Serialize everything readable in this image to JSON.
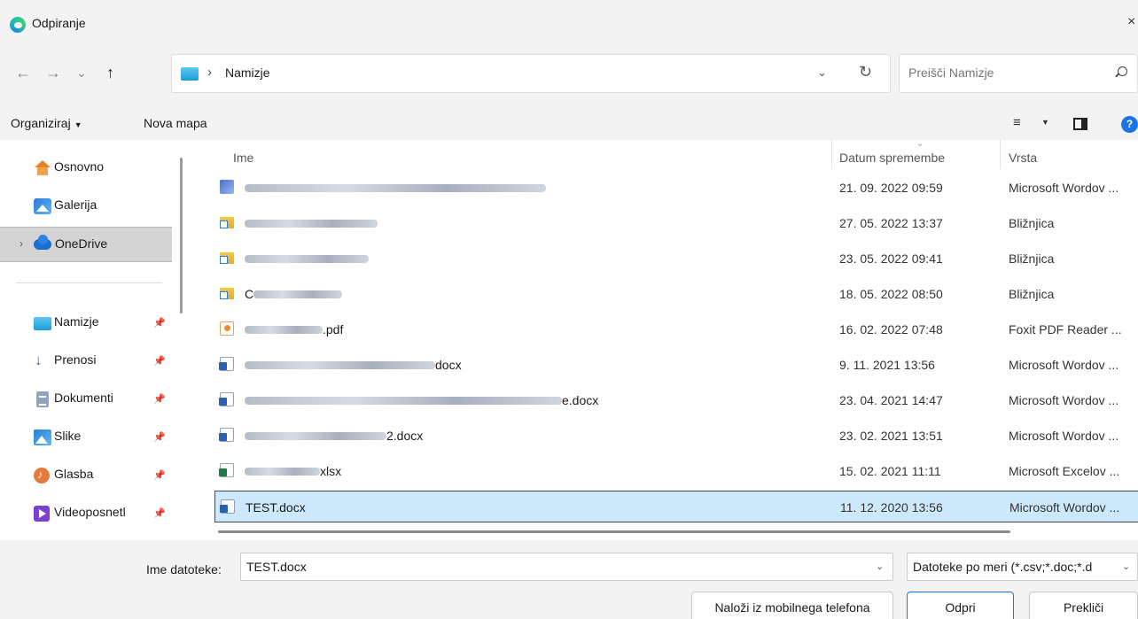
{
  "window": {
    "title": "Odpiranje",
    "close_glyph": "×"
  },
  "nav": {
    "back": "←",
    "forward": "→",
    "recent": "⌄",
    "up": "↑"
  },
  "address": {
    "separator": "›",
    "path": "Namizje",
    "dropdown": "⌄",
    "refresh": "↻"
  },
  "search": {
    "placeholder": "Preišči Namizje",
    "value": ""
  },
  "toolbar": {
    "organize": "Organiziraj",
    "organize_caret": "▼",
    "new_folder": "Nova mapa",
    "view_glyph": "≡",
    "view_caret": "▼",
    "help": "?"
  },
  "sidebar": {
    "items": [
      {
        "label": "Osnovno",
        "icon": "home-icon",
        "pinned": false
      },
      {
        "label": "Galerija",
        "icon": "gallery-icon",
        "pinned": false
      },
      {
        "label": "OneDrive",
        "icon": "cloud-icon",
        "pinned": false,
        "selected": true,
        "expander": "›"
      },
      {
        "label": "Namizje",
        "icon": "desktop-icon",
        "pinned": true
      },
      {
        "label": "Prenosi",
        "icon": "download-icon",
        "pinned": true
      },
      {
        "label": "Dokumenti",
        "icon": "documents-icon",
        "pinned": true
      },
      {
        "label": "Slike",
        "icon": "pictures-icon",
        "pinned": true
      },
      {
        "label": "Glasba",
        "icon": "music-icon",
        "pinned": true
      },
      {
        "label": "Videoposnetl",
        "icon": "video-icon",
        "pinned": true
      }
    ],
    "pin_glyph": "📌",
    "download_glyph": "↓"
  },
  "columns": {
    "name": "Ime",
    "date": "Datum spremembe",
    "type": "Vrsta",
    "sort_glyph": "⌄"
  },
  "files": [
    {
      "name_suffix": "",
      "date": "21. 09. 2022 09:59",
      "type": "Microsoft Wordov ...",
      "icon": "generic-doc-icon"
    },
    {
      "name_suffix": "",
      "date": "27. 05. 2022 13:37",
      "type": "Bližnjica",
      "icon": "shortcut-folder-icon"
    },
    {
      "name_suffix": "",
      "date": "23. 05. 2022 09:41",
      "type": "Bližnjica",
      "icon": "shortcut-folder-icon"
    },
    {
      "name_suffix": "",
      "name_prefix": "C",
      "date": "18. 05. 2022 08:50",
      "type": "Bližnjica",
      "icon": "shortcut-folder-icon"
    },
    {
      "name_suffix": ".pdf",
      "date": "16. 02. 2022 07:48",
      "type": "Foxit PDF Reader ...",
      "icon": "pdf-icon"
    },
    {
      "name_suffix": "docx",
      "date": "9. 11. 2021 13:56",
      "type": "Microsoft Wordov ...",
      "icon": "word-icon"
    },
    {
      "name_suffix": "e.docx",
      "date": "23. 04. 2021 14:47",
      "type": "Microsoft Wordov ...",
      "icon": "word-icon"
    },
    {
      "name_suffix": "2.docx",
      "date": "23. 02. 2021 13:51",
      "type": "Microsoft Wordov ...",
      "icon": "word-icon"
    },
    {
      "name_suffix": "xlsx",
      "date": "15. 02. 2021 11:11",
      "type": "Microsoft Excelov ...",
      "icon": "excel-icon"
    },
    {
      "name_suffix": "",
      "name": "TEST.docx",
      "date": "11. 12. 2020 13:56",
      "type": "Microsoft Wordov ...",
      "icon": "word-icon",
      "selected": true
    }
  ],
  "bottom": {
    "filename_label": "Ime datoteke:",
    "filename_value": "TEST.docx",
    "filename_dropdown": "⌄",
    "filter": "Datoteke po meri (*.csv;*.doc;*.d",
    "filter_dropdown": "⌄",
    "upload_mobile": "Naloži iz mobilnega telefona",
    "open": "Odpri",
    "cancel": "Prekliči"
  },
  "colors": {
    "accent": "#1a73e8",
    "selection": "#cde8fa",
    "chrome": "#f3f3f3"
  }
}
